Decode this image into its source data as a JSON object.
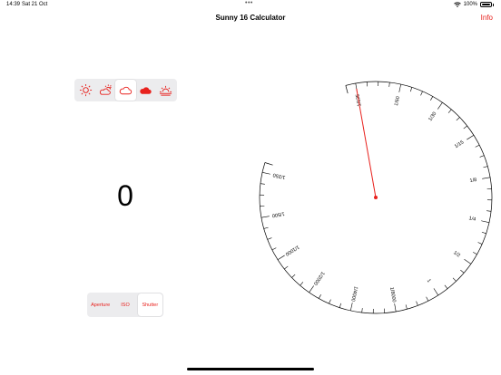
{
  "status": {
    "time": "14:39",
    "date": "Sat 21 Oct",
    "dots": "•••",
    "battery": "100%"
  },
  "nav": {
    "title": "Sunny 16 Calculator",
    "info": "Info"
  },
  "weather": {
    "options": [
      "sunny",
      "slight-overcast",
      "overcast",
      "heavy-overcast",
      "sunset"
    ],
    "selected": "overcast",
    "accent": "#e8211d"
  },
  "display": {
    "value": "0"
  },
  "mode": {
    "options": [
      "Aperture",
      "ISO",
      "Shutter"
    ],
    "selected": "Shutter"
  },
  "dial": {
    "labels": [
      "1/125",
      "1/60",
      "1/30",
      "1/15",
      "1/8",
      "1/4",
      "1/2",
      "1",
      "1/8000",
      "1/4000",
      "1/2000",
      "1/1000",
      "1/500",
      "1/250"
    ],
    "pointer_value": "1/125",
    "needle_color": "#e8211d"
  }
}
